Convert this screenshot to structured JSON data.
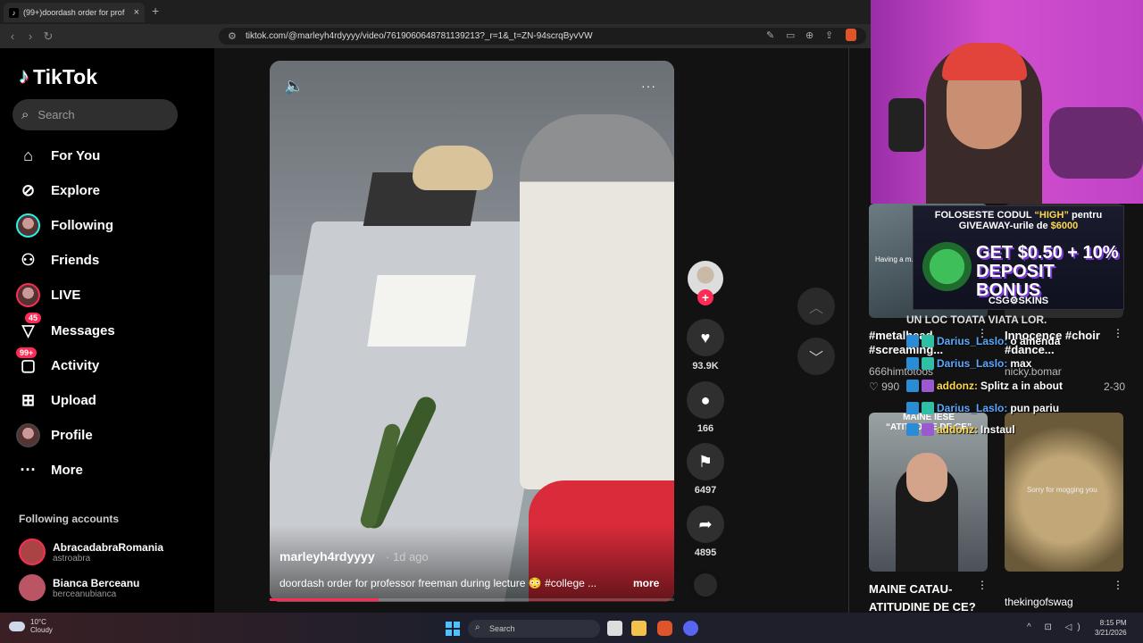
{
  "browser": {
    "tab_title": "(99+)doordash order for prof",
    "tab_close": "×",
    "new_tab": "+",
    "url": "tiktok.com/@marleyh4rdyyyy/video/7619060648781139213?_r=1&_t=ZN-94scrqByvVW"
  },
  "sidebar": {
    "logo": "TikTok",
    "search_placeholder": "Search",
    "items": [
      {
        "label": "For You",
        "icon": "home-icon"
      },
      {
        "label": "Explore",
        "icon": "compass-icon"
      },
      {
        "label": "Following",
        "icon": "avatar-icon"
      },
      {
        "label": "Friends",
        "icon": "friends-icon"
      },
      {
        "label": "LIVE",
        "icon": "live-icon"
      },
      {
        "label": "Messages",
        "icon": "messages-icon",
        "badge": "45"
      },
      {
        "label": "Activity",
        "icon": "activity-icon",
        "badge": "99+"
      },
      {
        "label": "Upload",
        "icon": "upload-icon"
      },
      {
        "label": "Profile",
        "icon": "profile-icon"
      },
      {
        "label": "More",
        "icon": "more-icon"
      }
    ],
    "following_heading": "Following accounts",
    "accounts": [
      {
        "name": "AbracadabraRomania",
        "handle": "astroabra"
      },
      {
        "name": "Bianca Berceanu",
        "handle": "berceanubianca"
      }
    ]
  },
  "video": {
    "author": "marleyh4rdyyyy",
    "time": "· 1d ago",
    "caption": "doordash order for professor freeman during lecture 😳 #college ...",
    "more": "more",
    "progress": 0.27,
    "actions": {
      "likes": "93.9K",
      "comments": "166",
      "saves": "6497",
      "shares": "4895"
    }
  },
  "stream": {
    "ad_line1_a": "FOLOSESTE CODUL",
    "ad_line1_b": "“HIGH”",
    "ad_line1_c": "pentru",
    "ad_line2_a": "GIVEAWAY-urile de",
    "ad_line2_b": "$6000",
    "ad_big1": "GET $0.50 + 10%",
    "ad_big2": "DEPOSIT BONUS",
    "ad_brand": "CSG⚙SKINS",
    "overlay_title": "UN LOC TOATA VIATA LOR.",
    "chat": [
      {
        "user": "Darius_Laslo:",
        "msg": "o amenda"
      },
      {
        "user": "Darius_Laslo:",
        "msg": "max"
      },
      {
        "user": "addonz:",
        "msg": "Splitz a in about"
      },
      {
        "user": "Darius_Laslo:",
        "msg": "pun pariu"
      },
      {
        "user": "addonz:",
        "msg": "Instaul"
      }
    ]
  },
  "recommendations": {
    "t1_overlay": "Having a m...",
    "t1_title": "#metalhead #screaming...",
    "t1_user": "666himtotoos",
    "t1_likes": "♡ 990",
    "t2_title": "Innocence #choir #dance...",
    "t2_user": "nicky.bomar",
    "t2_date": "2-30",
    "t3_overlay": "MAINE IESE “ATITUDINE DE CE”",
    "t3_title": "MAINE CATAU-ATITUDINE DE CE?",
    "t4_overlay": "Sorry for mogging you",
    "t4_title": "thekingofswag"
  },
  "taskbar": {
    "temp": "10°C",
    "weather": "Cloudy",
    "search": "Search",
    "time": "8:15 PM",
    "date": "3/21/2026"
  }
}
